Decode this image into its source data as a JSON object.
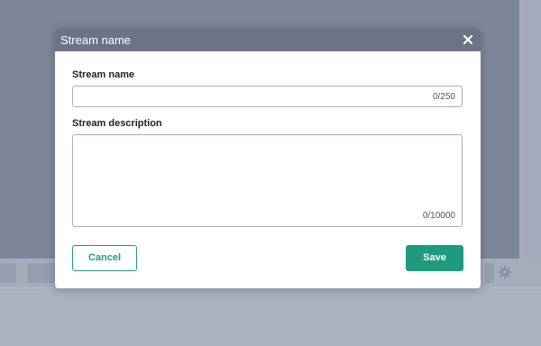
{
  "dialog": {
    "title": "Stream name",
    "close_icon": "close-icon",
    "name_field": {
      "label": "Stream name",
      "value": "",
      "placeholder": "",
      "counter": "0/250"
    },
    "description_field": {
      "label": "Stream description",
      "value": "",
      "placeholder": "",
      "counter": "0/10000"
    },
    "cancel_label": "Cancel",
    "save_label": "Save"
  },
  "background": {
    "settings_icon": "gear-icon"
  },
  "colors": {
    "header": "#6b7487",
    "accent": "#1e9b7f",
    "overlay": "#7e8799"
  }
}
